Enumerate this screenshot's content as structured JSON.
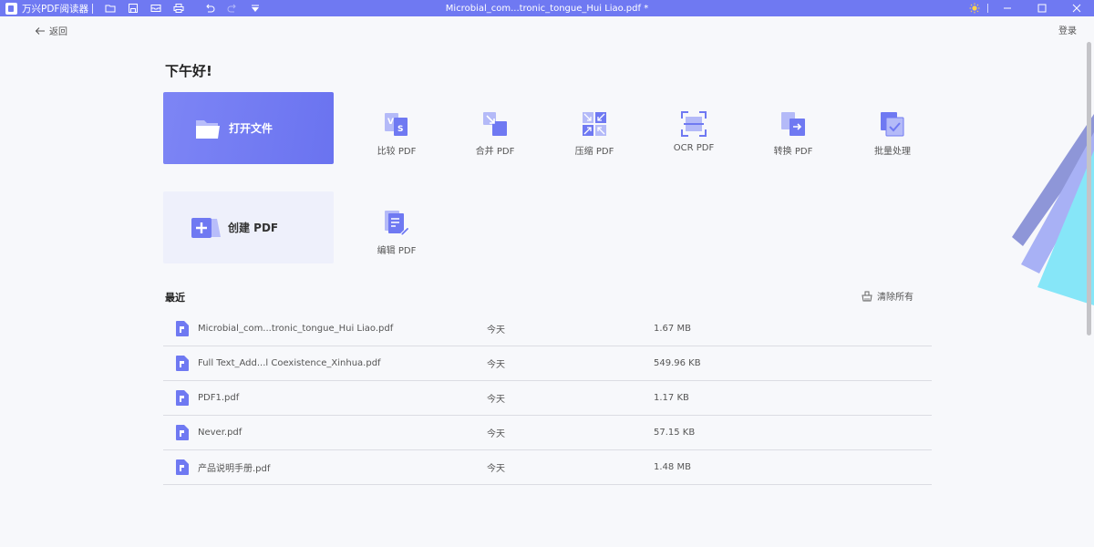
{
  "titlebar": {
    "app_name": "万兴PDF阅读器",
    "doc_title": "Microbial_com...tronic_tongue_Hui Liao.pdf *",
    "toolbar_icons": [
      "folder-icon",
      "save-icon",
      "mail-icon",
      "print-icon",
      "undo-icon",
      "redo-icon",
      "dropdown-icon"
    ],
    "window_buttons": [
      "theme-sun-icon",
      "minimize-icon",
      "maximize-icon",
      "close-icon"
    ],
    "bg_color": "#6f79f2"
  },
  "nav": {
    "back_label": "返回",
    "login_label": "登录"
  },
  "greeting": "下午好!",
  "cards": {
    "open_label": "打开文件",
    "create_label": "创建 PDF"
  },
  "tools": [
    {
      "label": "比较 PDF",
      "icon": "compare-icon"
    },
    {
      "label": "合并 PDF",
      "icon": "merge-icon"
    },
    {
      "label": "压缩 PDF",
      "icon": "compress-icon"
    },
    {
      "label": "OCR PDF",
      "icon": "ocr-icon"
    },
    {
      "label": "转换 PDF",
      "icon": "convert-icon"
    },
    {
      "label": "批量处理",
      "icon": "batch-icon"
    },
    {
      "label": "编辑 PDF",
      "icon": "edit-icon"
    }
  ],
  "recent": {
    "title": "最近",
    "clear_label": "清除所有",
    "files": [
      {
        "name": "Microbial_com...tronic_tongue_Hui Liao.pdf",
        "date": "今天",
        "size": "1.67 MB"
      },
      {
        "name": "Full Text_Add...l Coexistence_Xinhua.pdf",
        "date": "今天",
        "size": "549.96 KB"
      },
      {
        "name": "PDF1.pdf",
        "date": "今天",
        "size": "1.17 KB"
      },
      {
        "name": "Never.pdf",
        "date": "今天",
        "size": "57.15 KB"
      },
      {
        "name": "产品说明手册.pdf",
        "date": "今天",
        "size": "1.48 MB"
      }
    ]
  },
  "colors": {
    "accent": "#6f79f2",
    "icon_light": "#a9b0f7"
  }
}
